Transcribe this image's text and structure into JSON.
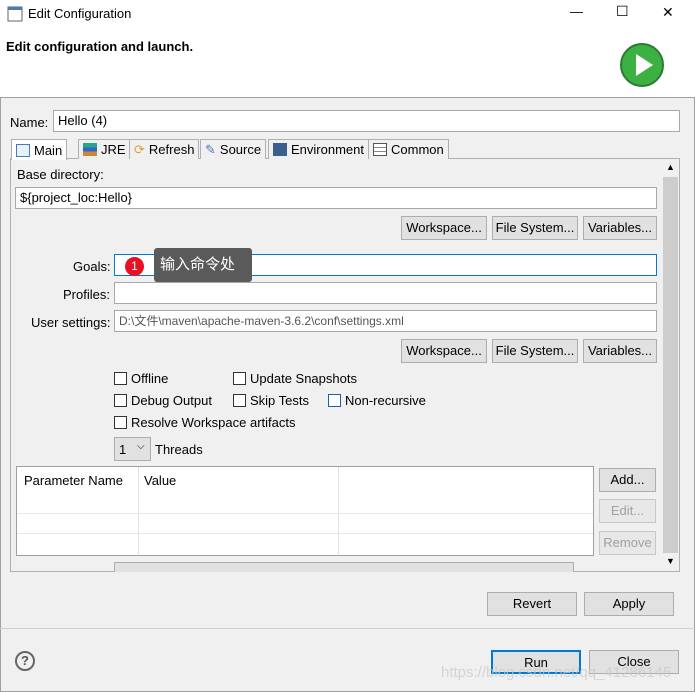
{
  "window": {
    "title": "Edit Configuration",
    "minimize": "—",
    "maximize": "☐",
    "close": "✕"
  },
  "header": {
    "subtitle": "Edit configuration and launch."
  },
  "name": {
    "label": "Name:",
    "value": "Hello (4)"
  },
  "tabs": [
    {
      "label": "Main",
      "icon": "main-tab-icon"
    },
    {
      "label": "JRE",
      "icon": "library-icon"
    },
    {
      "label": "Refresh",
      "icon": "refresh-icon"
    },
    {
      "label": "Source",
      "icon": "source-icon"
    },
    {
      "label": "Environment",
      "icon": "environment-icon"
    },
    {
      "label": "Common",
      "icon": "common-icon"
    }
  ],
  "main": {
    "base_dir_label": "Base directory:",
    "base_dir_value": "${project_loc:Hello}",
    "workspace": "Workspace...",
    "filesystem": "File System...",
    "variables": "Variables...",
    "goals_label": "Goals:",
    "goals_value": "",
    "tooltip_badge": "1",
    "tooltip_text": "输入命令处",
    "profiles_label": "Profiles:",
    "profiles_value": "",
    "user_settings_label": "User settings:",
    "user_settings_value": "D:\\文件\\maven\\apache-maven-3.6.2\\conf\\settings.xml",
    "offline": "Offline",
    "update_snapshots": "Update Snapshots",
    "debug_output": "Debug Output",
    "skip_tests": "Skip Tests",
    "non_recursive": "Non-recursive",
    "resolve_workspace": "Resolve Workspace artifacts",
    "threads_value": "1",
    "threads_label": "Threads",
    "param_headers": [
      "Parameter Name",
      "Value"
    ],
    "add": "Add...",
    "edit": "Edit...",
    "remove": "Remove"
  },
  "footer": {
    "revert": "Revert",
    "apply": "Apply",
    "run": "Run",
    "close": "Close",
    "help": "?"
  },
  "watermark": "https://blog.csdn.net/qq_41286145",
  "colors": {
    "accent": "#0078d7",
    "run_icon": "#3cb043",
    "badge": "#e81123"
  }
}
